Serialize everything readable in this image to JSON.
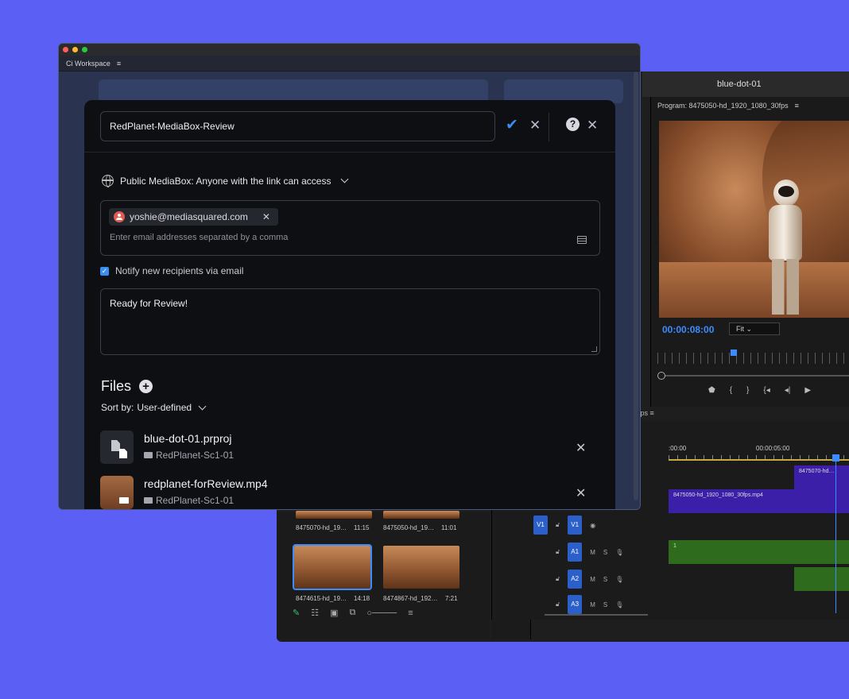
{
  "premiere": {
    "sequence_title": "blue-dot-01",
    "program_label": "Program: 8475050-hd_1920_1080_30fps",
    "timecode": "00:00:08:00",
    "fit_label": "Fit",
    "timeline_tab": "fps",
    "ruler_labels": [
      ":00:00",
      "00:00:05:00"
    ],
    "clips": {
      "v2": "8475070-hd…",
      "v1": "8475050-hd_1920_1080_30fps.mp4",
      "a1_num": "1"
    },
    "tracks": [
      {
        "name": "V1",
        "target": "V1"
      },
      {
        "name": "",
        "target": "A1"
      },
      {
        "name": "",
        "target": "A2"
      },
      {
        "name": "",
        "target": "A3"
      }
    ],
    "track_btn_m": "M",
    "track_btn_s": "S",
    "bin_items": [
      {
        "name": "8475070-hd_19…",
        "duration": "11:15"
      },
      {
        "name": "8475050-hd_19…",
        "duration": "11:01"
      },
      {
        "name": "8474615-hd_19…",
        "duration": "14:18"
      },
      {
        "name": "8474867-hd_192…",
        "duration": "7:21"
      }
    ]
  },
  "ci": {
    "window_title": "Ci Workspace",
    "menu_icon": "≡",
    "mediabox_name": "RedPlanet-MediaBox-Review",
    "access_label": "Public MediaBox: Anyone with the link can access",
    "recipient_chip": "yoshie@mediasquared.com",
    "email_placeholder": "Enter email addresses separated by a comma",
    "notify_label": "Notify new recipients via email",
    "message": "Ready for Review!",
    "files_heading": "Files",
    "sort_prefix": "Sort by:",
    "sort_value": "User-defined",
    "files": [
      {
        "name": "blue-dot-01.prproj",
        "folder": "RedPlanet-Sc1-01",
        "kind": "document"
      },
      {
        "name": "redplanet-forReview.mp4",
        "folder": "RedPlanet-Sc1-01",
        "kind": "video"
      }
    ]
  },
  "colors": {
    "background": "#5b5ff3",
    "accent_blue": "#3a8ef0",
    "modal_bg": "#0e0f13",
    "traffic_red": "#ff5f57",
    "traffic_yellow": "#febc2e",
    "traffic_green": "#28c840"
  },
  "icons": [
    "check-icon",
    "close-icon",
    "help-icon",
    "globe-icon",
    "chevron-down-icon",
    "user-avatar-icon",
    "address-book-icon",
    "checkbox-icon",
    "plus-icon",
    "folder-icon",
    "document-icon",
    "video-icon"
  ]
}
